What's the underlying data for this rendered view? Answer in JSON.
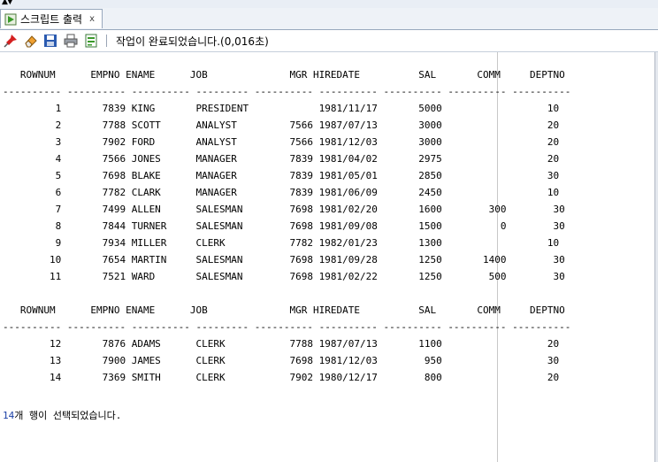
{
  "tab": {
    "label": "스크립트 출력",
    "close": "x"
  },
  "toolbar": {
    "icons": [
      "pin-icon",
      "eraser-icon",
      "save-icon",
      "print-icon",
      "output-icon"
    ],
    "status": "작업이 완료되었습니다.(0,016초)"
  },
  "output": {
    "header": "   ROWNUM      EMPNO ENAME      JOB              MGR HIREDATE          SAL       COMM     DEPTNO",
    "separator": "---------- ---------- ---------- --------- ---------- ---------- ---------- ---------- ----------",
    "rows1": [
      "         1       7839 KING       PRESIDENT            1981/11/17       5000                  10",
      "         2       7788 SCOTT      ANALYST         7566 1987/07/13       3000                  20",
      "         3       7902 FORD       ANALYST         7566 1981/12/03       3000                  20",
      "         4       7566 JONES      MANAGER         7839 1981/04/02       2975                  20",
      "         5       7698 BLAKE      MANAGER         7839 1981/05/01       2850                  30",
      "         6       7782 CLARK      MANAGER         7839 1981/06/09       2450                  10",
      "         7       7499 ALLEN      SALESMAN        7698 1981/02/20       1600        300        30",
      "         8       7844 TURNER     SALESMAN        7698 1981/09/08       1500          0        30",
      "         9       7934 MILLER     CLERK           7782 1982/01/23       1300                  10",
      "        10       7654 MARTIN     SALESMAN        7698 1981/09/28       1250       1400        30",
      "        11       7521 WARD       SALESMAN        7698 1981/02/22       1250        500        30"
    ],
    "rows2": [
      "        12       7876 ADAMS      CLERK           7788 1987/07/13       1100                  20",
      "        13       7900 JAMES      CLERK           7698 1981/12/03        950                  30",
      "        14       7369 SMITH      CLERK           7902 1980/12/17        800                  20"
    ],
    "footer_count": "14",
    "footer_text": "개 행이 선택되었습니다."
  }
}
